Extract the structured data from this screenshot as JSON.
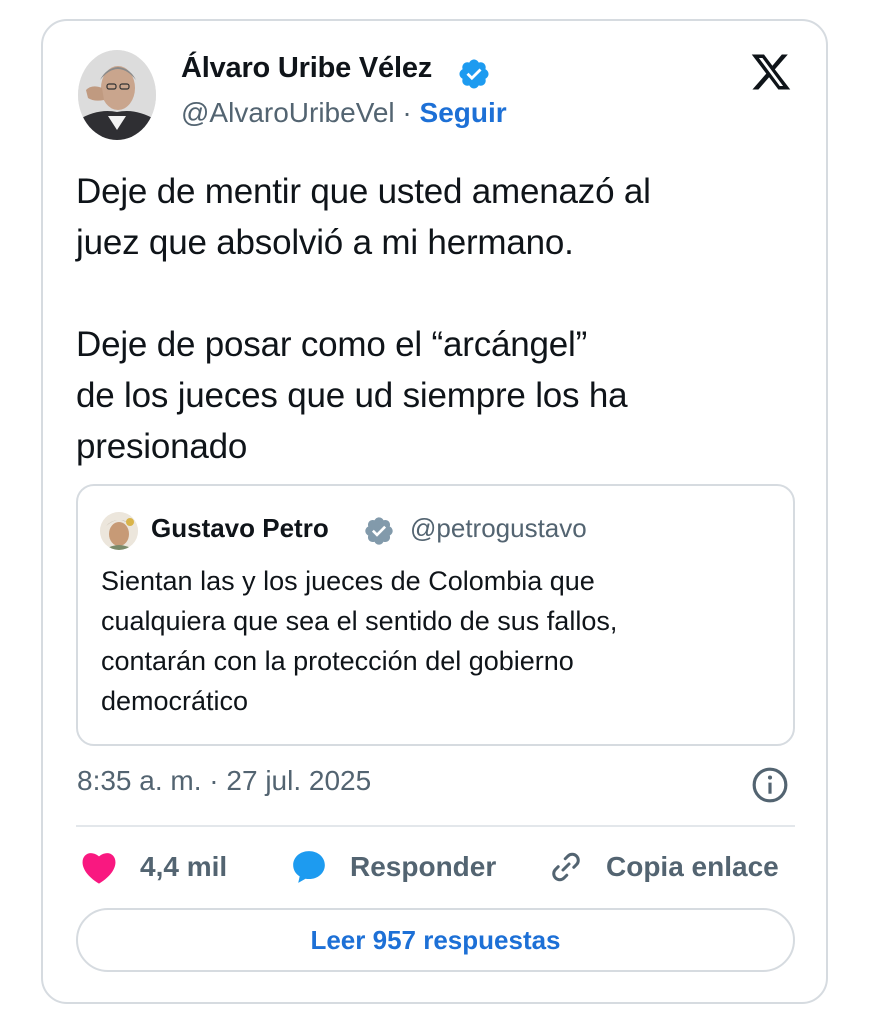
{
  "author": {
    "name": "Álvaro Uribe Vélez",
    "handle": "@AlvaroUribeVel",
    "separator": "·",
    "follow_label": "Seguir",
    "verified_icon": "verified-badge-icon",
    "avatar_icon": "avatar-photo"
  },
  "platform_logo": "x-logo-icon",
  "tweet": {
    "text": "Deje de mentir que usted amenazó al\njuez que absolvió a mi hermano.\n\nDeje de posar como el “arcángel”\nde los jueces que ud siempre los ha\npresionado"
  },
  "quoted": {
    "name": "Gustavo Petro",
    "handle": "@petrogustavo",
    "text": "Sientan las y los jueces de Colombia que\ncualquiera que sea el sentido de sus fallos,\ncontarán con la protección del gobierno\ndemocrático"
  },
  "meta": {
    "timestamp": "8:35 a. m. · 27 jul. 2025",
    "info_icon": "info-icon"
  },
  "actions": {
    "likes": "4,4 mil",
    "reply_label": "Responder",
    "copy_label": "Copia enlace"
  },
  "read_replies_label": "Leer 957 respuestas",
  "colors": {
    "accent": "#1d70d6",
    "verified": "#1d9bf0",
    "heart": "#f91880",
    "muted_text": "#536471",
    "border": "#d6dbe0"
  }
}
